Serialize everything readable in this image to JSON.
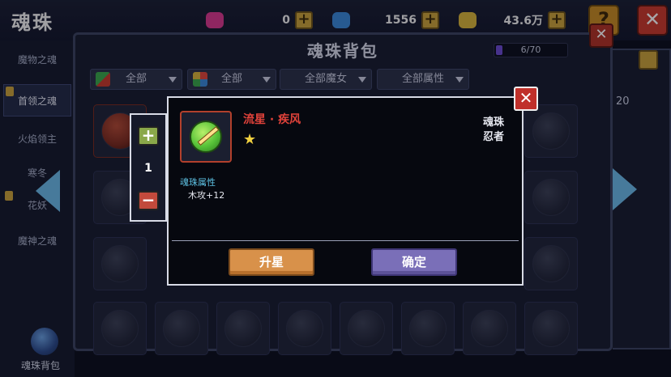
{
  "header": {
    "title": "魂珠",
    "resources": [
      {
        "value": "0",
        "icon": "pink-gem-icon",
        "color": "#d9388e"
      },
      {
        "value": "1556",
        "icon": "blue-gem-icon",
        "color": "#3a88d8"
      },
      {
        "value": "43.6万",
        "icon": "gold-chest-icon",
        "color": "#d8b43a"
      }
    ]
  },
  "sidebar": {
    "items": [
      {
        "label": "魔物之魂"
      },
      {
        "label": "首领之魂"
      },
      {
        "label": "火焰领主"
      },
      {
        "label": "寒冬"
      },
      {
        "label": "花妖"
      },
      {
        "label": "魔神之魂"
      }
    ],
    "bag_label": "魂珠背包"
  },
  "panel": {
    "title": "魂珠背包",
    "capacity": "6/70",
    "capacity_fraction": 0.086,
    "side_count": "20",
    "filters": [
      {
        "label": "全部"
      },
      {
        "label": "全部"
      },
      {
        "label": "全部魔女"
      },
      {
        "label": "全部属性"
      }
    ]
  },
  "stepper": {
    "value": "1"
  },
  "dialog": {
    "item_name": "流星 · 疾风",
    "stars": "★",
    "type_line1": "魂珠",
    "type_line2": "忍者",
    "attr_title": "魂珠属性",
    "attr_value": "木攻+12",
    "upgrade_label": "升星",
    "confirm_label": "确定"
  }
}
